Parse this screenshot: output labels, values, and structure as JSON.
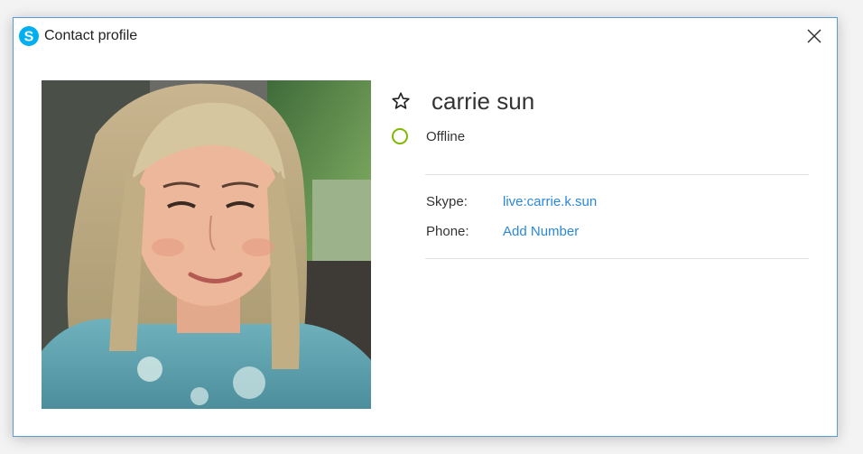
{
  "window": {
    "title": "Contact profile",
    "app_icon": "skype-icon",
    "close_icon": "close-icon"
  },
  "profile": {
    "name": "carrie sun",
    "status": "Offline",
    "status_color": "#7fba00",
    "favorite_icon": "star-outline-icon",
    "photo_alt": "carrie sun"
  },
  "details": {
    "skype_label": "Skype:",
    "skype_value": "live:carrie.k.sun",
    "phone_label": "Phone:",
    "phone_value": "Add Number",
    "link_color": "#2b88d8"
  }
}
